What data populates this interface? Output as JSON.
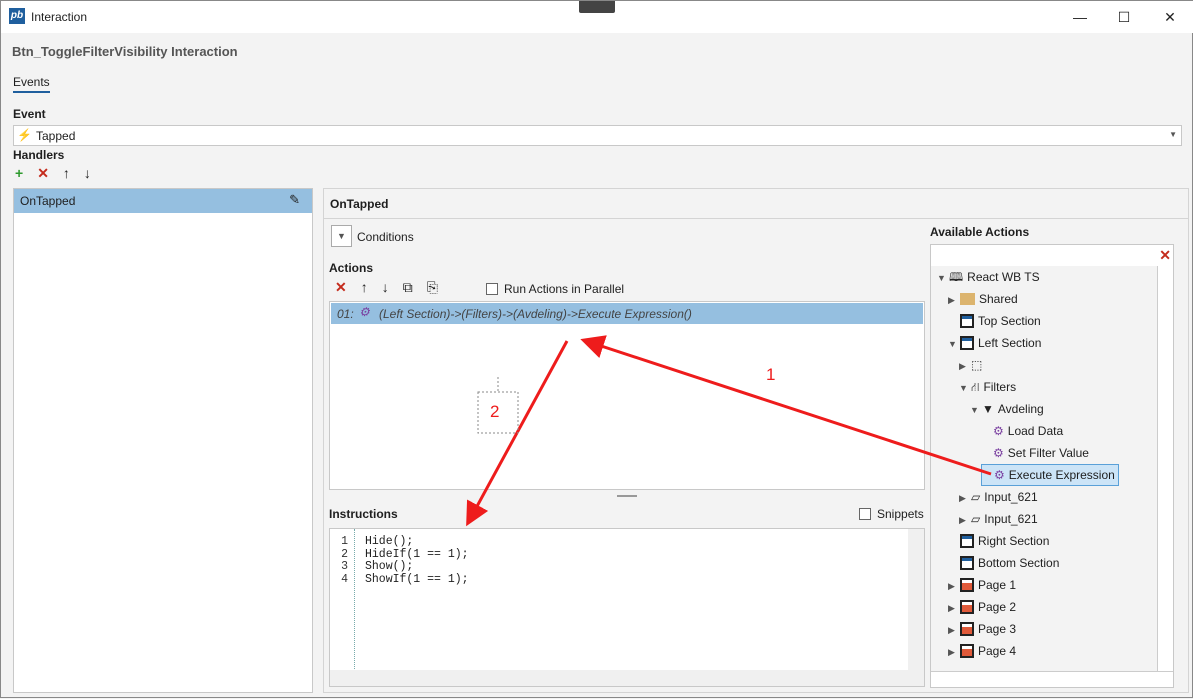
{
  "window": {
    "title": "Interaction",
    "logo": "pb",
    "minimize": "—",
    "maximize": "☐",
    "close": "✕"
  },
  "header": {
    "title": "Btn_ToggleFilterVisibility Interaction",
    "tab": "Events"
  },
  "event": {
    "label": "Event",
    "value": "Tapped",
    "icon": "lightning-icon"
  },
  "handlers": {
    "label": "Handlers",
    "items": [
      "OnTapped"
    ]
  },
  "handler_panel": {
    "title": "OnTapped",
    "conditions": "Conditions",
    "actions_label": "Actions",
    "run_parallel": "Run Actions in Parallel",
    "actions": [
      {
        "index": "01:",
        "text": "(Left Section)->(Filters)->(Avdeling)->Execute Expression()"
      }
    ]
  },
  "instructions": {
    "label": "Instructions",
    "snippets": "Snippets",
    "lines": [
      {
        "n": "1",
        "code": "Hide();"
      },
      {
        "n": "2",
        "code": "HideIf(1 == 1);"
      },
      {
        "n": "3",
        "code": "Show();"
      },
      {
        "n": "4",
        "code": "ShowIf(1 == 1);"
      }
    ]
  },
  "available": {
    "label": "Available Actions",
    "search": "",
    "tree": [
      {
        "label": "React WB TS",
        "level": 0,
        "exp": "▼",
        "icon": "book"
      },
      {
        "label": "Shared",
        "level": 1,
        "exp": "▶",
        "icon": "folder"
      },
      {
        "label": "Top Section",
        "level": 1,
        "exp": "",
        "icon": "section"
      },
      {
        "label": "Left Section",
        "level": 1,
        "exp": "▼",
        "icon": "section"
      },
      {
        "label": "",
        "level": 2,
        "exp": "▶",
        "icon": "select"
      },
      {
        "label": "Filters",
        "level": 2,
        "exp": "▼",
        "icon": "hierarchy"
      },
      {
        "label": "Avdeling",
        "level": 3,
        "exp": "▼",
        "icon": "funnel"
      },
      {
        "label": "Load Data",
        "level": 4,
        "exp": "",
        "icon": "action"
      },
      {
        "label": "Set Filter Value",
        "level": 4,
        "exp": "",
        "icon": "action"
      },
      {
        "label": "Execute Expression",
        "level": 4,
        "exp": "",
        "icon": "action",
        "selected": true
      },
      {
        "label": "Input_621",
        "level": 2,
        "exp": "▶",
        "icon": "input"
      },
      {
        "label": "Input_621",
        "level": 2,
        "exp": "▶",
        "icon": "input"
      },
      {
        "label": "Right Section",
        "level": 1,
        "exp": "",
        "icon": "section"
      },
      {
        "label": "Bottom Section",
        "level": 1,
        "exp": "",
        "icon": "section"
      },
      {
        "label": "Page 1",
        "level": 1,
        "exp": "▶",
        "icon": "page"
      },
      {
        "label": "Page 2",
        "level": 1,
        "exp": "▶",
        "icon": "page"
      },
      {
        "label": "Page 3",
        "level": 1,
        "exp": "▶",
        "icon": "page"
      },
      {
        "label": "Page 4",
        "level": 1,
        "exp": "▶",
        "icon": "page"
      }
    ]
  },
  "annotations": {
    "one": "1",
    "two": "2",
    "color": "#ee1c1c"
  }
}
